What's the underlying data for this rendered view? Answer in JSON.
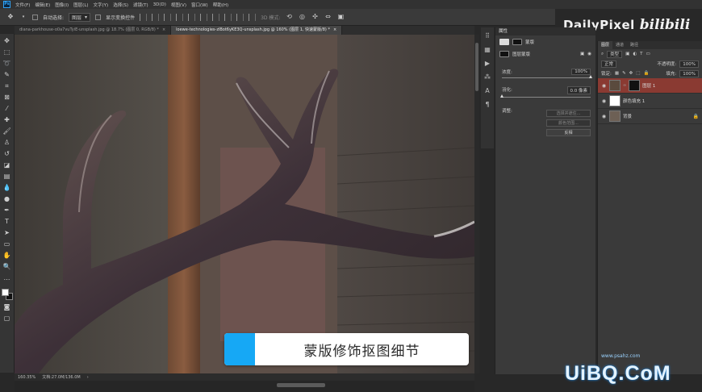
{
  "app": {
    "logo": "Ps",
    "menu": [
      "文件(F)",
      "编辑(E)",
      "图像(I)",
      "图层(L)",
      "文字(Y)",
      "选择(S)",
      "滤镜(T)",
      "3D(D)",
      "视图(V)",
      "窗口(W)",
      "帮助(H)"
    ]
  },
  "options": {
    "auto_select_label": "自动选择:",
    "auto_select_target": "图层",
    "show_transform_label": "显示变换控件",
    "mode_3d_label": "3D 模式:"
  },
  "tabs": [
    {
      "label": "diana-parkhouse-o0a7vuTyiE-unsplash.jpg @ 18.7% (图层 0, RGB/8) *",
      "close": "×"
    },
    {
      "label": "loewe-technologies-zlBot6yKE3Q-unsplash.jpg @ 160% (图层 1, 快速蒙版/8) *",
      "close": "×"
    }
  ],
  "status": {
    "zoom": "160.35%",
    "doc": "文档:27.0M/136.0M",
    "arrow": "›"
  },
  "caption": {
    "text": "蒙版修饰抠图细节",
    "accent": "#16a8f5"
  },
  "watermark": {
    "brand": "DailyPixel",
    "bili": "bilibili",
    "bottom": "UiBQ.CoM",
    "bottom_small": "www.psahz.com"
  },
  "properties": {
    "title": "属性",
    "mask_label": "蒙版",
    "layer_mask_label": "图层蒙版",
    "density_label": "浓度:",
    "density_value": "100%",
    "feather_label": "羽化:",
    "feather_value": "0.0 像素",
    "adjust_label": "调整:",
    "btn_select_mask": "选择并遮住...",
    "btn_color_range": "颜色范围...",
    "btn_invert": "反相"
  },
  "layers_panel": {
    "tabs": [
      "图层",
      "通道",
      "路径"
    ],
    "filter_kind": "类型",
    "blend_mode": "正常",
    "opacity_label": "不透明度:",
    "opacity_value": "100%",
    "lock_label": "锁定:",
    "fill_label": "填充:",
    "fill_value": "100%",
    "layers": [
      {
        "name": "图层 1",
        "active": true
      },
      {
        "name": "颜色填充 1",
        "active": false
      },
      {
        "name": "背景",
        "active": false
      }
    ]
  }
}
